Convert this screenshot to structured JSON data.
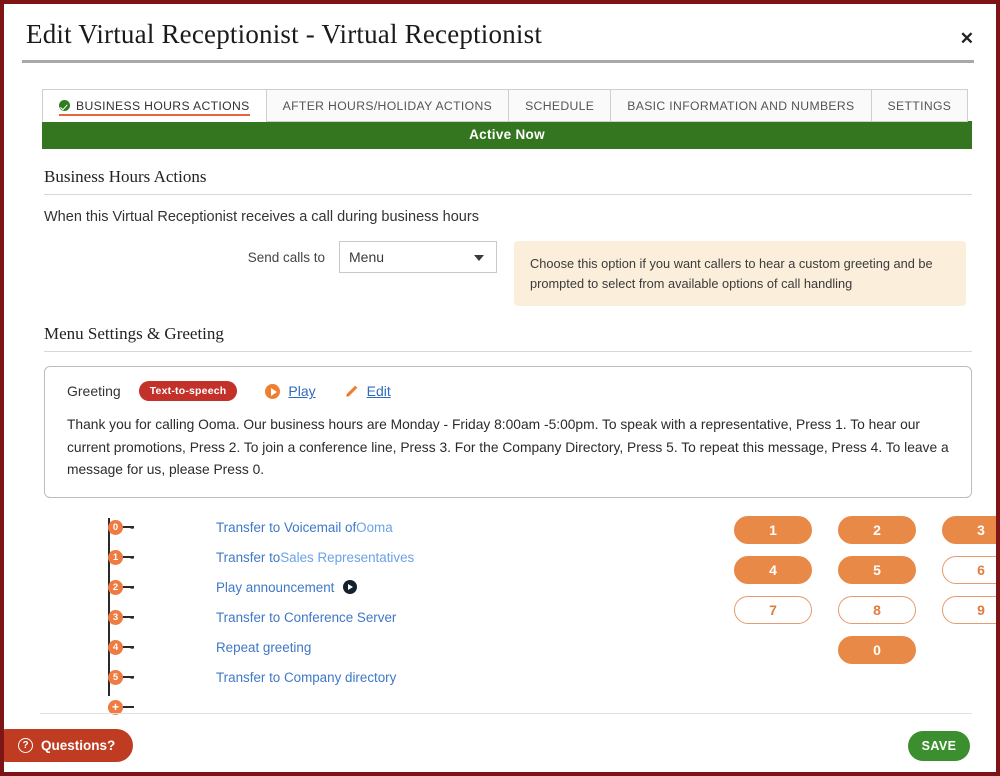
{
  "header": {
    "title": "Edit Virtual Receptionist - Virtual Receptionist",
    "close_label": "✕"
  },
  "tabs": [
    {
      "label": "BUSINESS HOURS ACTIONS",
      "active": true,
      "checked": true
    },
    {
      "label": "AFTER HOURS/HOLIDAY ACTIONS",
      "active": false,
      "checked": false
    },
    {
      "label": "SCHEDULE",
      "active": false,
      "checked": false
    },
    {
      "label": "BASIC INFORMATION AND NUMBERS",
      "active": false,
      "checked": false
    },
    {
      "label": "SETTINGS",
      "active": false,
      "checked": false
    }
  ],
  "status_bar": {
    "label": "Active Now",
    "color": "#33761f"
  },
  "business_hours": {
    "section_title": "Business Hours Actions",
    "lead": "When this Virtual Receptionist receives a call during business hours",
    "send_calls_label": "Send calls to",
    "send_calls_value": "Menu",
    "hint": "Choose this option if you want callers to hear a custom greeting and be prompted to select from available options of call handling",
    "hint_bg": "#fbeedb"
  },
  "menu_settings": {
    "section_title": "Menu Settings & Greeting",
    "greeting_label": "Greeting",
    "tts_badge": "Text-to-speech",
    "play_link": "Play",
    "edit_link": "Edit",
    "greeting_text": "Thank you for calling Ooma. Our business hours are Monday - Friday 8:00am -5:00pm. To speak with a representative, Press 1. To hear our current promotions, Press 2. To join a conference line, Press 3. For the Company Directory, Press 5. To repeat this message, Press 4. To leave a message for us, please Press 0."
  },
  "tree": {
    "dash": "-",
    "add_label": "+",
    "nodes": [
      {
        "digit": "0",
        "action": "Transfer to Voicemail of ",
        "target": "Ooma",
        "has_play": false,
        "indent": 146
      },
      {
        "digit": "1",
        "action": "Transfer to ",
        "target": "Sales Representatives",
        "has_play": false,
        "indent": 146
      },
      {
        "digit": "2",
        "action": "Play announcement",
        "target": "",
        "has_play": true,
        "indent": 146
      },
      {
        "digit": "3",
        "action": "Transfer to Conference Server",
        "target": "",
        "has_play": false,
        "indent": 146
      },
      {
        "digit": "4",
        "action": "Repeat greeting",
        "target": "",
        "has_play": false,
        "indent": 146
      },
      {
        "digit": "5",
        "action": "Transfer to Company directory",
        "target": "",
        "has_play": false,
        "indent": 146
      }
    ]
  },
  "keypad": {
    "keys": [
      {
        "label": "1",
        "assigned": true
      },
      {
        "label": "2",
        "assigned": true
      },
      {
        "label": "3",
        "assigned": true
      },
      {
        "label": "4",
        "assigned": true
      },
      {
        "label": "5",
        "assigned": true
      },
      {
        "label": "6",
        "assigned": false
      },
      {
        "label": "7",
        "assigned": false
      },
      {
        "label": "8",
        "assigned": false
      },
      {
        "label": "9",
        "assigned": false
      },
      {
        "label": "0",
        "assigned": true
      }
    ],
    "assigned_color": "#e98948",
    "unassigned_color": "#ffffff"
  },
  "footer": {
    "questions_label": "Questions?",
    "questions_icon": "?",
    "save_label": "SAVE",
    "save_color": "#3b8f2e",
    "questions_color": "#bf3c22"
  }
}
